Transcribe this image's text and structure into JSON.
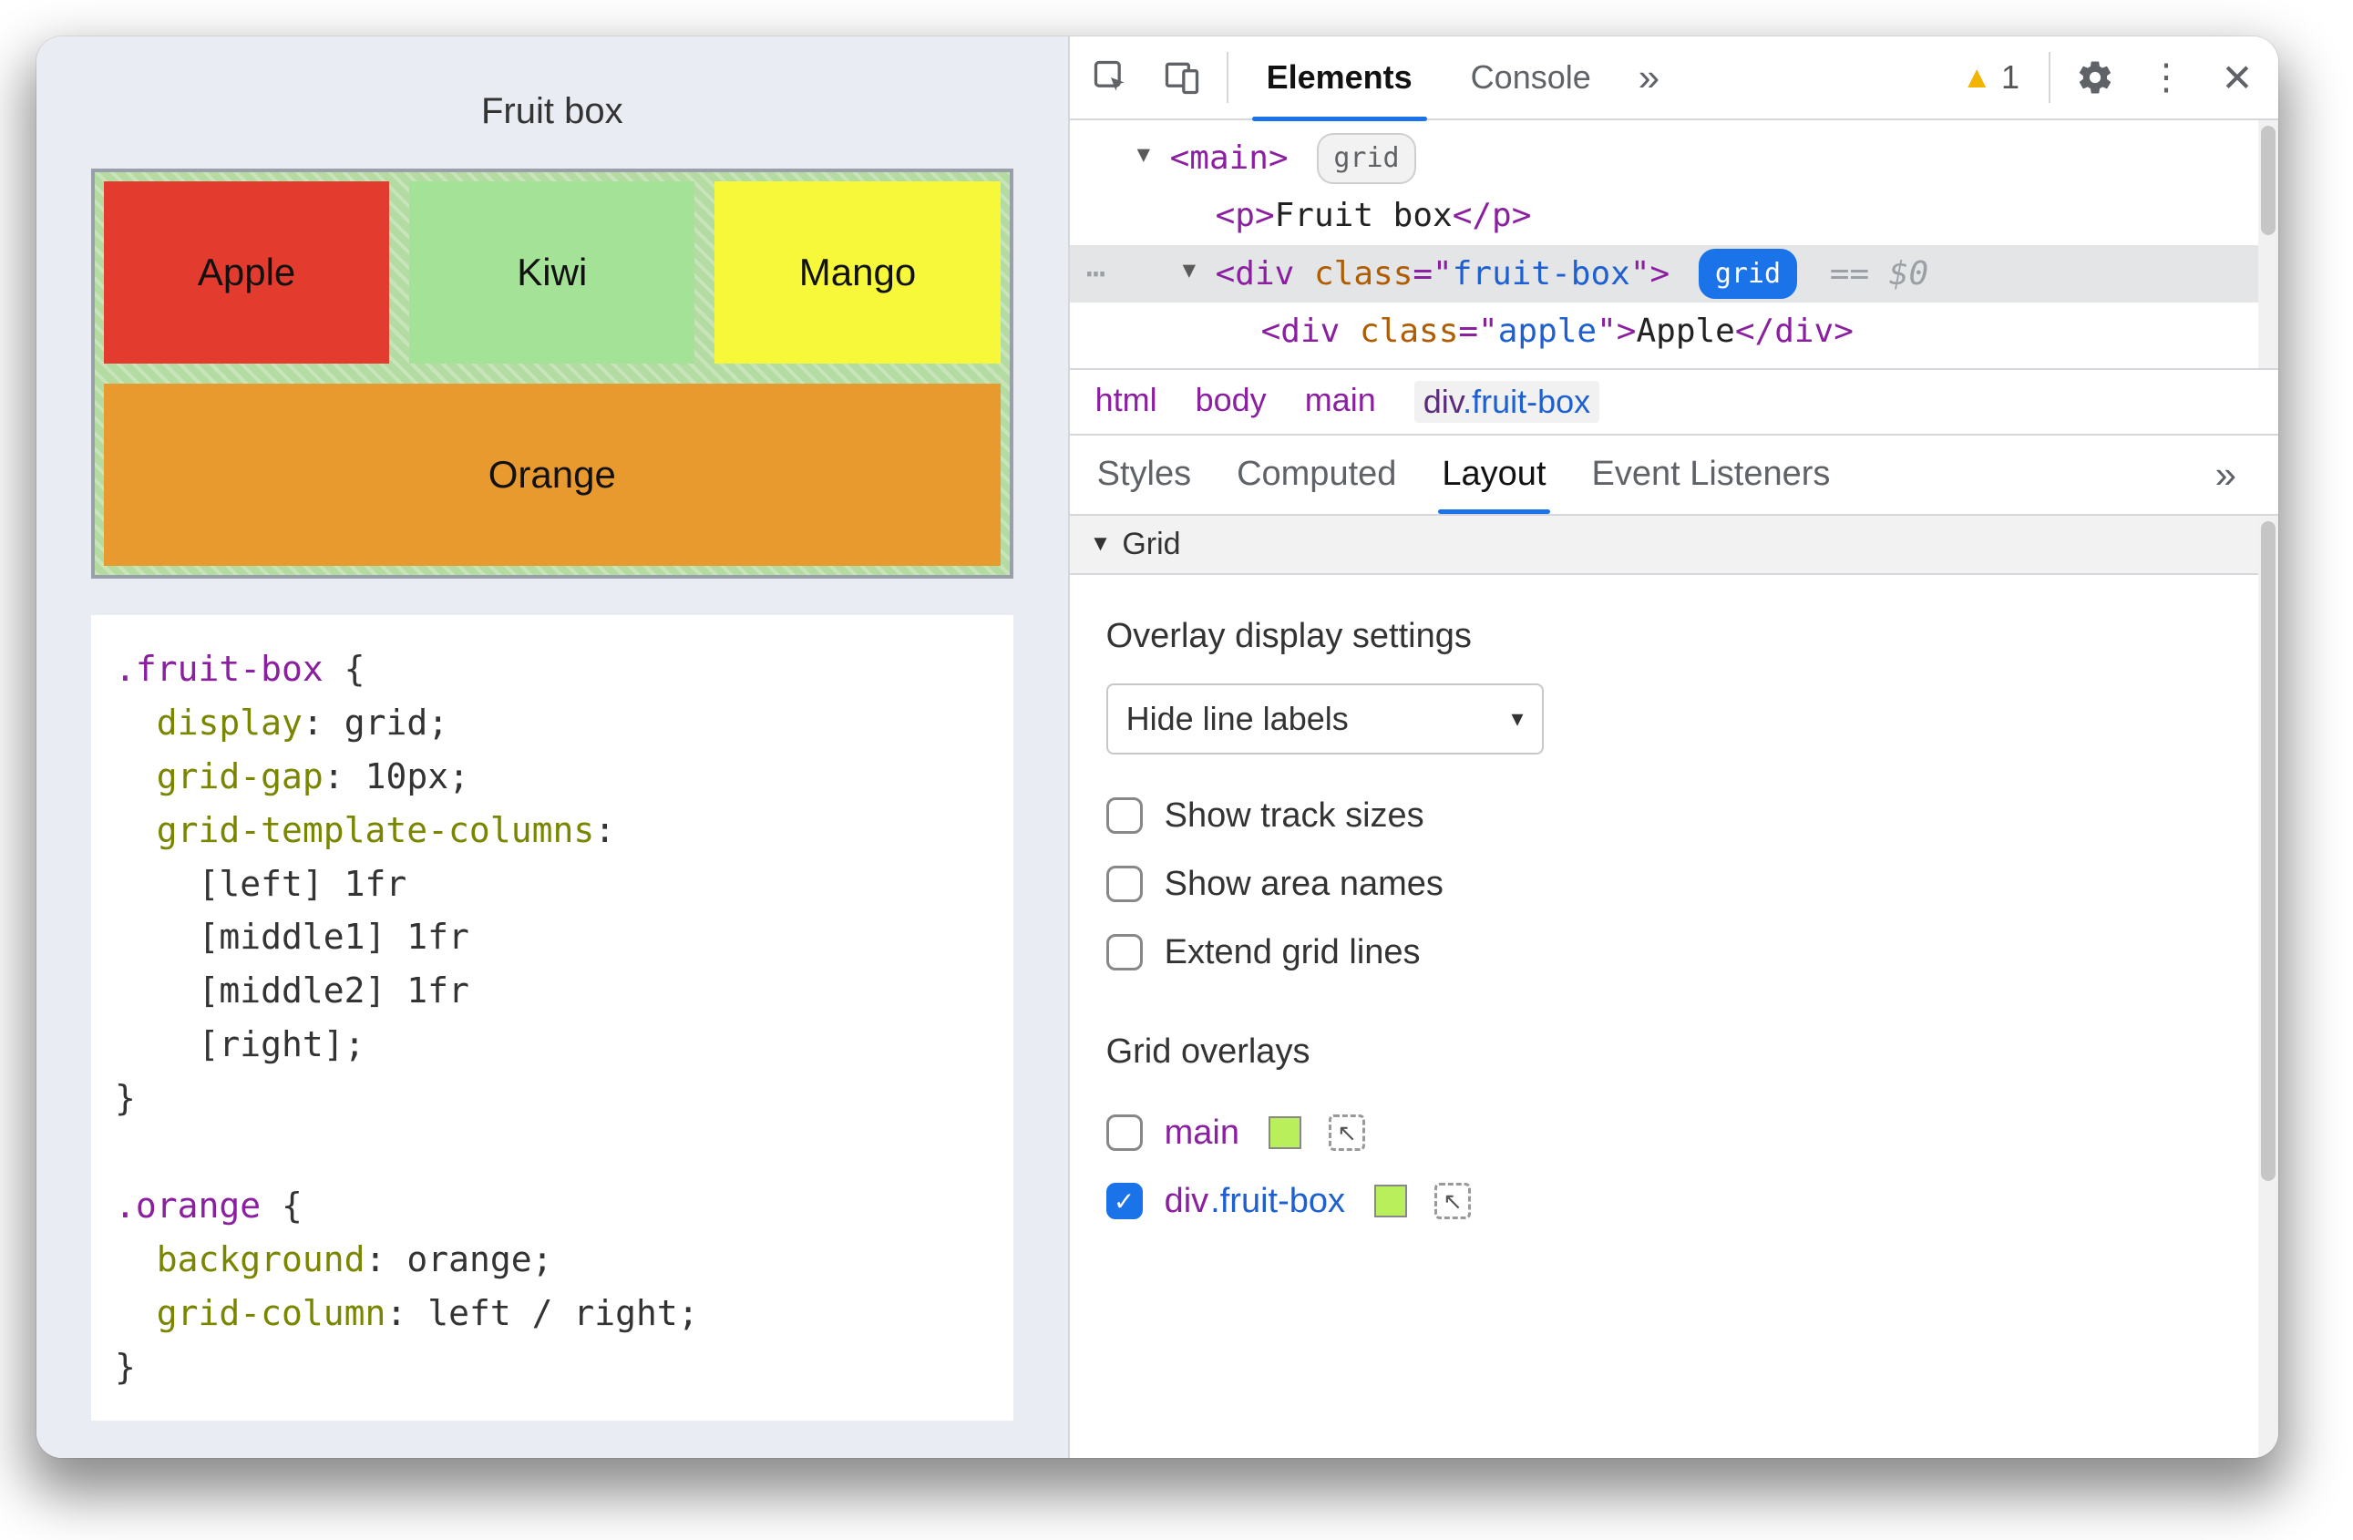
{
  "page": {
    "title": "Fruit box",
    "cells": {
      "apple": "Apple",
      "kiwi": "Kiwi",
      "mango": "Mango",
      "orange": "Orange"
    },
    "css_lines": [
      {
        "t": "sel",
        "v": ".fruit-box"
      },
      {
        "t": "punc",
        "v": " {"
      },
      {
        "t": "br"
      },
      {
        "t": "sp",
        "v": "  "
      },
      {
        "t": "prop",
        "v": "display"
      },
      {
        "t": "punc",
        "v": ": "
      },
      {
        "t": "val",
        "v": "grid"
      },
      {
        "t": "punc",
        "v": ";"
      },
      {
        "t": "br"
      },
      {
        "t": "sp",
        "v": "  "
      },
      {
        "t": "prop",
        "v": "grid-gap"
      },
      {
        "t": "punc",
        "v": ": "
      },
      {
        "t": "val",
        "v": "10px"
      },
      {
        "t": "punc",
        "v": ";"
      },
      {
        "t": "br"
      },
      {
        "t": "sp",
        "v": "  "
      },
      {
        "t": "prop",
        "v": "grid-template-columns"
      },
      {
        "t": "punc",
        "v": ":"
      },
      {
        "t": "br"
      },
      {
        "t": "sp",
        "v": "    "
      },
      {
        "t": "val",
        "v": "[left] 1fr"
      },
      {
        "t": "br"
      },
      {
        "t": "sp",
        "v": "    "
      },
      {
        "t": "val",
        "v": "[middle1] 1fr"
      },
      {
        "t": "br"
      },
      {
        "t": "sp",
        "v": "    "
      },
      {
        "t": "val",
        "v": "[middle2] 1fr"
      },
      {
        "t": "br"
      },
      {
        "t": "sp",
        "v": "    "
      },
      {
        "t": "val",
        "v": "[right]"
      },
      {
        "t": "punc",
        "v": ";"
      },
      {
        "t": "br"
      },
      {
        "t": "punc",
        "v": "}"
      },
      {
        "t": "br"
      },
      {
        "t": "br"
      },
      {
        "t": "sel",
        "v": ".orange"
      },
      {
        "t": "punc",
        "v": " {"
      },
      {
        "t": "br"
      },
      {
        "t": "sp",
        "v": "  "
      },
      {
        "t": "prop",
        "v": "background"
      },
      {
        "t": "punc",
        "v": ": "
      },
      {
        "t": "val",
        "v": "orange"
      },
      {
        "t": "punc",
        "v": ";"
      },
      {
        "t": "br"
      },
      {
        "t": "sp",
        "v": "  "
      },
      {
        "t": "prop",
        "v": "grid-column"
      },
      {
        "t": "punc",
        "v": ": "
      },
      {
        "t": "val",
        "v": "left / right"
      },
      {
        "t": "punc",
        "v": ";"
      },
      {
        "t": "br"
      },
      {
        "t": "punc",
        "v": "}"
      }
    ]
  },
  "devtools": {
    "tabs": {
      "elements": "Elements",
      "console": "Console"
    },
    "more": "»",
    "warnings_count": "1",
    "dom": {
      "main_tag": "main",
      "main_badge": "grid",
      "p_text": "Fruit box",
      "div_tag": "div",
      "div_class_attr": "class",
      "div_class_val": "fruit-box",
      "div_badge": "grid",
      "eqzero": "== $0",
      "apple_class_val": "apple",
      "apple_text": "Apple"
    },
    "crumbs": [
      "html",
      "body",
      "main"
    ],
    "crumb_active_el": "div",
    "crumb_active_cls": ".fruit-box",
    "subtabs": {
      "styles": "Styles",
      "computed": "Computed",
      "layout": "Layout",
      "listeners": "Event Listeners"
    },
    "layout": {
      "grid_section": "Grid",
      "overlay_heading": "Overlay display settings",
      "line_labels_select": "Hide line labels",
      "show_track_sizes": "Show track sizes",
      "show_area_names": "Show area names",
      "extend_grid_lines": "Extend grid lines",
      "grid_overlays_heading": "Grid overlays",
      "overlays": {
        "main": "main",
        "fruitbox_el": "div",
        "fruitbox_cls": ".fruit-box"
      }
    }
  }
}
